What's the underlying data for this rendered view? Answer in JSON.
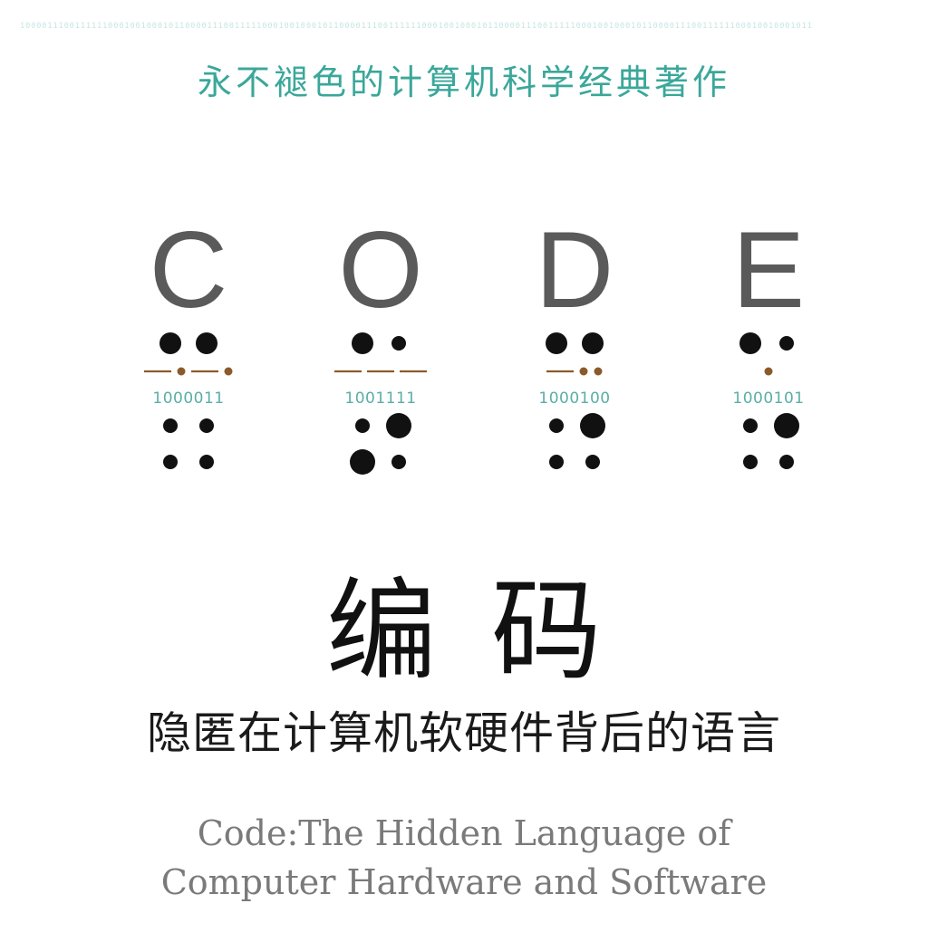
{
  "header": {
    "binary_strip": "100001110011111100010010001011000011100111110001001000101100001110011111100010010001011000011100111110001001000101100001110011111100010010001011",
    "tagline": "永不褪色的计算机科学经典著作"
  },
  "code_letters": [
    {
      "letter": "C",
      "binary": "1000011",
      "braille_top": [
        "big",
        "big"
      ],
      "morse": [
        "dash",
        "dot",
        "dash",
        "dot"
      ],
      "braille_bottom": [
        [
          "dot",
          "dot"
        ],
        [
          "dot",
          "dot"
        ]
      ]
    },
    {
      "letter": "O",
      "binary": "1001111",
      "braille_top": [
        "big",
        "dot"
      ],
      "morse": [
        "dash",
        "dash",
        "dash"
      ],
      "braille_bottom": [
        [
          "dot",
          "big"
        ],
        [
          "big",
          "dot"
        ]
      ]
    },
    {
      "letter": "D",
      "binary": "1000100",
      "braille_top": [
        "big",
        "big"
      ],
      "morse": [
        "dash",
        "dot",
        "dot"
      ],
      "braille_bottom": [
        [
          "dot",
          "big"
        ],
        [
          "dot",
          "dot"
        ]
      ]
    },
    {
      "letter": "E",
      "binary": "1000101",
      "braille_top": [
        "big",
        "dot"
      ],
      "morse": [
        "dot"
      ],
      "braille_bottom": [
        [
          "dot",
          "big"
        ],
        [
          "dot",
          "dot"
        ]
      ]
    }
  ],
  "colors": {
    "teal": "#3aa79a",
    "letter_gray": "#5a5a5a",
    "morse_brown": "#8b5a2b",
    "dot_black": "#111111"
  },
  "title_cn": "编码",
  "subtitle_cn": "隐匿在计算机软硬件背后的语言",
  "title_en": {
    "line1": "Code:The Hidden Language of",
    "line2": "Computer Hardware and Software"
  }
}
